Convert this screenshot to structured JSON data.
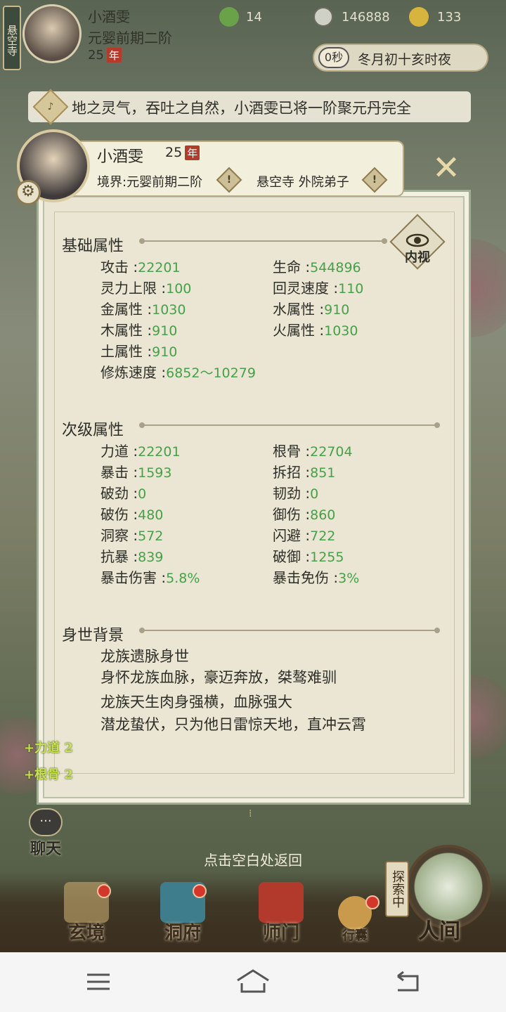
{
  "top": {
    "sect": "悬空寺",
    "name": "小酒雯",
    "realm": "元婴前期二阶",
    "age": "25",
    "age_unit": "年",
    "res1": "14",
    "res2": "146888",
    "res3": "133",
    "timer": "0秒",
    "time_text": "冬月初十亥时夜"
  },
  "notice": {
    "text": "地之灵气，吞吐之自然，小酒雯已将一阶聚元丹完全"
  },
  "panel": {
    "name": "小酒雯",
    "age": "25",
    "age_unit": "年",
    "realm": "境界:元婴前期二阶",
    "sect": "悬空寺 外院弟子",
    "inner_view": "内视",
    "basic_title": "基础属性",
    "basic": [
      {
        "label": "攻击",
        "value": "22201"
      },
      {
        "label": "生命",
        "value": "544896"
      },
      {
        "label": "灵力上限",
        "value": "100"
      },
      {
        "label": "回灵速度",
        "value": "110"
      },
      {
        "label": "金属性",
        "value": "1030"
      },
      {
        "label": "水属性",
        "value": "910"
      },
      {
        "label": "木属性",
        "value": "910"
      },
      {
        "label": "火属性",
        "value": "1030"
      },
      {
        "label": "土属性",
        "value": "910"
      },
      {
        "label": "修炼速度",
        "value": "6852～10279"
      }
    ],
    "secondary_title": "次级属性",
    "secondary": [
      {
        "label": "力道",
        "value": "22201"
      },
      {
        "label": "根骨",
        "value": "22704"
      },
      {
        "label": "暴击",
        "value": "1593"
      },
      {
        "label": "拆招",
        "value": "851"
      },
      {
        "label": "破劲",
        "value": "0"
      },
      {
        "label": "韧劲",
        "value": "0"
      },
      {
        "label": "破伤",
        "value": "480"
      },
      {
        "label": "御伤",
        "value": "860"
      },
      {
        "label": "洞察",
        "value": "572"
      },
      {
        "label": "闪避",
        "value": "722"
      },
      {
        "label": "抗暴",
        "value": "839"
      },
      {
        "label": "破御",
        "value": "1255"
      },
      {
        "label": "暴击伤害",
        "value": "5.8%"
      },
      {
        "label": "暴击免伤",
        "value": "3%"
      }
    ],
    "background_title": "身世背景",
    "background": [
      "龙族遗脉身世",
      "身怀龙族血脉，豪迈奔放，桀骜难驯",
      "龙族天生肉身强横，血脉强大",
      "潜龙蛰伏，只为他日雷惊天地，直冲云霄"
    ]
  },
  "bonuses": [
    "+力道 2",
    "+根骨 2"
  ],
  "hint": "点击空白处返回",
  "chat_label": "聊天",
  "nav": {
    "xuanjing": "玄境",
    "dongfu": "洞府",
    "shimen": "师门",
    "xingnang": "行囊",
    "explore": "探索中",
    "renjian": "人间"
  },
  "icons": {
    "gear": "gear-icon",
    "close": "close-icon",
    "eye": "eye-icon",
    "bell": "bell-icon",
    "warning": "warning-icon"
  }
}
